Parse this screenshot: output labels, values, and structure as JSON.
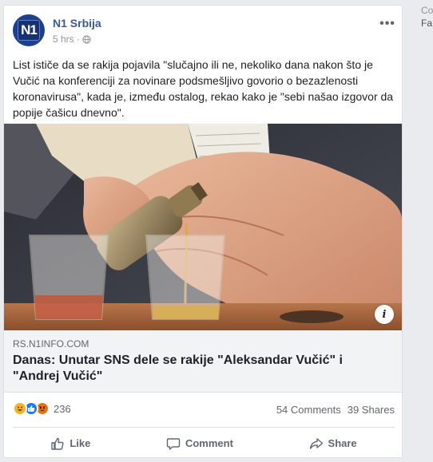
{
  "post": {
    "page_name": "N1 Srbija",
    "avatar_text": "N1",
    "time": "5 hrs",
    "more_label": "•••",
    "text": "List ističe da se rakija pojavila \"slučajno ili ne, nekoliko dana nakon što je Vučić na konferenciji za novinare podsmešljivo govorio o bezazlenosti koronavirusa\", kada je, između ostalog, rekao kako je \"sebi našao izgovor da popije čašicu dnevno\"."
  },
  "link": {
    "domain": "RS.N1INFO.COM",
    "title": "Danas: Unutar SNS dele se rakije \"Aleksandar Vučić\" i \"Andrej Vučić\"",
    "info_label": "i"
  },
  "stats": {
    "reaction_count": "236",
    "comments": "54 Comments",
    "shares": "39 Shares"
  },
  "actions": {
    "like": "Like",
    "comment": "Comment",
    "share": "Share"
  },
  "sidebar": {
    "line1": "Co",
    "line2": "Fa"
  },
  "colors": {
    "page_name": "#385898",
    "background": "#e9ebee",
    "link_bg": "#f2f3f5"
  }
}
